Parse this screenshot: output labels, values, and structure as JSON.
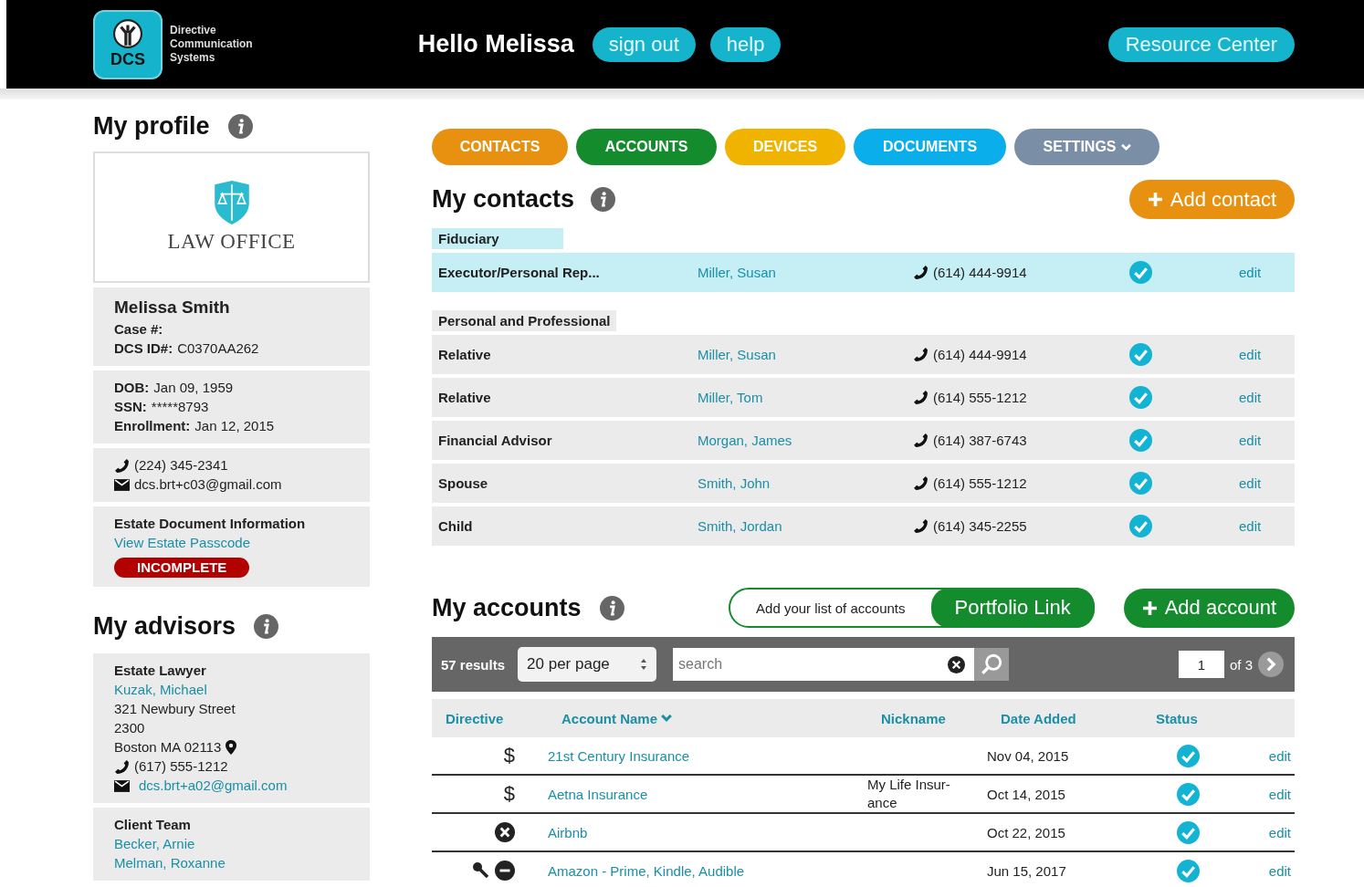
{
  "header": {
    "logo_mark": "DCS",
    "logo_text": [
      "Directive",
      "Communication",
      "Systems"
    ],
    "greeting": "Hello Melissa",
    "buttons": [
      "sign out",
      "help"
    ],
    "resource_button": "Resource Center"
  },
  "profile": {
    "title": "My profile",
    "logo_text": "LAW OFFICE",
    "name": "Melissa Smith",
    "case_label": "Case #:",
    "id_label": "DCS ID#:",
    "id_value": "C0370AA262",
    "details": [
      {
        "label": "DOB:",
        "value": "Jan 09, 1959"
      },
      {
        "label": "SSN:",
        "value": "*****8793"
      },
      {
        "label": "Enrollment:",
        "value": "Jan 12, 2015"
      }
    ],
    "phone": "(224) 345-2341",
    "email": "dcs.brt+c03@gmail.com",
    "estate_title": "Estate Document Information",
    "estate_link": "View Estate Passcode",
    "estate_status": "INCOMPLETE"
  },
  "advisors": {
    "title": "My advisors",
    "cards": [
      {
        "role": "Estate Lawyer",
        "names": [
          "Kuzak, Michael"
        ],
        "address": [
          "321 Newbury Street",
          "2300",
          "Boston MA 02113"
        ],
        "phone": "(617) 555-1212",
        "email": "dcs.brt+a02@gmail.com"
      },
      {
        "role": "Client Team",
        "names": [
          "Becker, Arnie",
          "Melman, Roxanne"
        ]
      }
    ]
  },
  "tabs": [
    {
      "label": "CONTACTS",
      "color": "#e8900f",
      "dropdown": false
    },
    {
      "label": "ACCOUNTS",
      "color": "#148c2e",
      "dropdown": false
    },
    {
      "label": "DEVICES",
      "color": "#f0b400",
      "dropdown": false
    },
    {
      "label": "DOCUMENTS",
      "color": "#09aeea",
      "dropdown": false
    },
    {
      "label": "SETTINGS",
      "color": "#7a8fa6",
      "dropdown": true
    }
  ],
  "contacts": {
    "title": "My contacts",
    "add_button": "Add contact",
    "groups": [
      {
        "name": "Fiduciary",
        "color": "#c5eef5",
        "rows": [
          {
            "role": "Executor/Personal Rep...",
            "name": "Miller, Susan",
            "phone": "(614) 444-9914",
            "verified": true,
            "action": "edit"
          }
        ]
      },
      {
        "name": "Personal and Professional",
        "color": "#ebebeb",
        "rows": [
          {
            "role": "Relative",
            "name": "Miller, Susan",
            "phone": "(614) 444-9914",
            "verified": true,
            "action": "edit"
          },
          {
            "role": "Relative",
            "name": "Miller, Tom",
            "phone": "(614) 555-1212",
            "verified": true,
            "action": "edit"
          },
          {
            "role": "Financial Advisor",
            "name": "Morgan, James",
            "phone": "(614) 387-6743",
            "verified": true,
            "action": "edit"
          },
          {
            "role": "Spouse",
            "name": "Smith, John",
            "phone": "(614) 555-1212",
            "verified": true,
            "action": "edit"
          },
          {
            "role": "Child",
            "name": "Smith, Jordan",
            "phone": "(614) 345-2255",
            "verified": true,
            "action": "edit"
          }
        ]
      }
    ]
  },
  "accounts": {
    "title": "My accounts",
    "portfolio_prompt": "Add your list of accounts",
    "portfolio_button": "Portfolio Link",
    "add_button": "Add account",
    "toolbar": {
      "results": "57 results",
      "per_page": "20 per page",
      "search_placeholder": "search",
      "page": "1",
      "page_total": "of 3"
    },
    "columns": [
      {
        "label": "Directive",
        "sorted": false
      },
      {
        "label": "Account Name",
        "sorted": true
      },
      {
        "label": "Nickname",
        "sorted": false
      },
      {
        "label": "Date Added",
        "sorted": false
      },
      {
        "label": "Status",
        "sorted": false
      }
    ],
    "rows": [
      {
        "kind": "dollar",
        "symbol": "$",
        "name": "21st Century Insurance",
        "nickname": "",
        "date": "Nov 04, 2015",
        "verified": true,
        "action": "edit"
      },
      {
        "kind": "dollar",
        "symbol": "$",
        "name": "Aetna Insurance",
        "nickname": "My Life Insur-ance",
        "date": "Oct 14, 2015",
        "verified": true,
        "action": "edit"
      },
      {
        "kind": "closed",
        "name": "Airbnb",
        "nickname": "",
        "date": "Oct 22, 2015",
        "verified": true,
        "action": "edit"
      },
      {
        "kind": "tools",
        "name": "Amazon - Prime, Kindle, Audible",
        "nickname": "",
        "date": "Jun 15, 2017",
        "verified": true,
        "action": "edit"
      }
    ]
  }
}
